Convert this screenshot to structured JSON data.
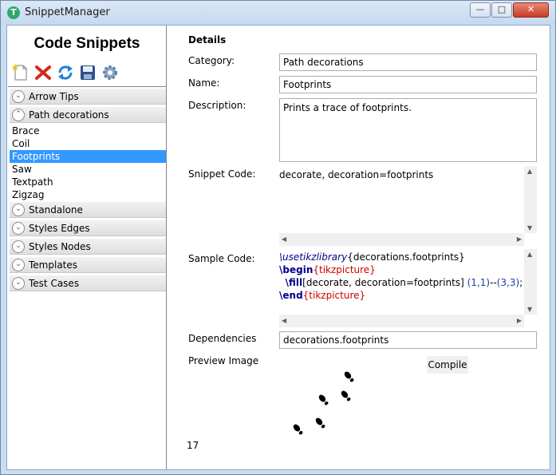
{
  "window": {
    "title": "SnippetManager",
    "icon_letter": "T",
    "min_glyph": "—",
    "max_glyph": "□",
    "close_glyph": "✕"
  },
  "left": {
    "title": "Code Snippets",
    "toolbar": [
      "new-snippet-icon",
      "delete-icon",
      "refresh-icon",
      "save-icon",
      "settings-icon"
    ],
    "groups": {
      "g0": {
        "label": "Arrow Tips",
        "expanded": false
      },
      "g1": {
        "label": "Path decorations",
        "expanded": true
      },
      "g2": {
        "label": "Standalone",
        "expanded": false
      },
      "g3": {
        "label": "Styles Edges",
        "expanded": false
      },
      "g4": {
        "label": "Styles Nodes",
        "expanded": false
      },
      "g5": {
        "label": "Templates",
        "expanded": false
      },
      "g6": {
        "label": "Test Cases",
        "expanded": false
      }
    },
    "items": [
      "Brace",
      "Coil",
      "Footprints",
      "Saw",
      "Textpath",
      "Zigzag"
    ],
    "selected_item": "Footprints"
  },
  "details": {
    "header": "Details",
    "category_label": "Category:",
    "category_value": "Path decorations",
    "name_label": "Name:",
    "name_value": "Footprints",
    "description_label": "Description:",
    "description_value": "Prints a trace of footprints.",
    "snippet_code_label": "Snippet Code:",
    "snippet_code_value": "decorate, decoration=footprints",
    "sample_code_label": "Sample Code:",
    "sample_code": {
      "l1_cmd": "\\usetikzlibrary",
      "l1_arg": "{decorations.footprints}",
      "l2_kw": "\\begin",
      "l2_env": "{tikzpicture}",
      "l3_kw": "\\fill",
      "l3_opts": "[decorate, decoration=footprints] ",
      "l3_p1": "(1,1)",
      "l3_dash": "--",
      "l3_p2": "(3,3)",
      "l3_end": ";",
      "l4_kw": "\\end",
      "l4_env": "{tikzpicture}"
    },
    "dependencies_label": "Dependencies",
    "dependencies_value": "decorations.footprints",
    "preview_label": "Preview Image",
    "compile_label": "Compile",
    "page_number": "17"
  },
  "colors": {
    "selection": "#3399ff",
    "keyword": "#00008b",
    "environment": "#cc0000"
  }
}
